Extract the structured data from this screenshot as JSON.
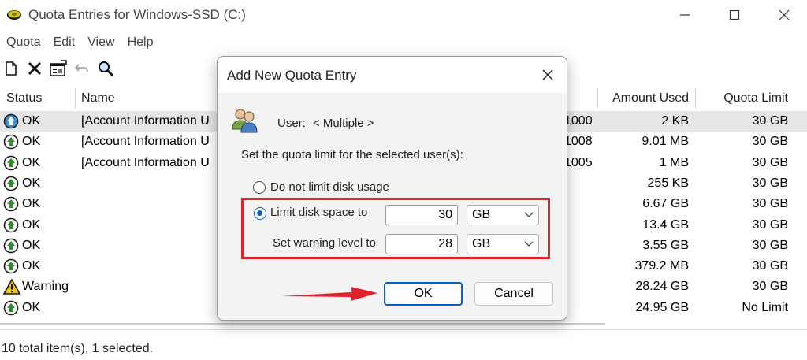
{
  "window": {
    "title": "Quota Entries for Windows-SSD (C:)",
    "controls": [
      "minimize",
      "maximize",
      "close"
    ]
  },
  "menu": [
    "Quota",
    "Edit",
    "View",
    "Help"
  ],
  "toolbar": {
    "icons": [
      "new-entry-icon",
      "delete-icon",
      "properties-icon",
      "undo-icon",
      "find-icon"
    ]
  },
  "table": {
    "columns": [
      "Status",
      "Name",
      "Amount Used",
      "Quota Limit"
    ],
    "rows": [
      {
        "status": "OK",
        "name": "[Account Information U",
        "login_tail": "1000",
        "used": "2 KB",
        "limit": "30 GB",
        "selected": true
      },
      {
        "status": "OK",
        "name": "[Account Information U",
        "login_tail": "1008",
        "used": "9.01 MB",
        "limit": "30 GB"
      },
      {
        "status": "OK",
        "name": "[Account Information U",
        "login_tail": "1005",
        "used": "1 MB",
        "limit": "30 GB"
      },
      {
        "status": "OK",
        "name": "",
        "login_tail": "",
        "used": "255 KB",
        "limit": "30 GB"
      },
      {
        "status": "OK",
        "name": "",
        "login_tail": "",
        "used": "6.67 GB",
        "limit": "30 GB"
      },
      {
        "status": "OK",
        "name": "",
        "login_tail": "",
        "used": "13.4 GB",
        "limit": "30 GB"
      },
      {
        "status": "OK",
        "name": "",
        "login_tail": "",
        "used": "3.55 GB",
        "limit": "30 GB"
      },
      {
        "status": "OK",
        "name": "",
        "login_tail": "",
        "used": "379.2 MB",
        "limit": "30 GB"
      },
      {
        "status": "Warning",
        "name": "",
        "login_tail": "",
        "used": "28.24 GB",
        "limit": "30 GB"
      },
      {
        "status": "OK",
        "name": "",
        "login_tail": "",
        "used": "24.95 GB",
        "limit": "No Limit"
      }
    ]
  },
  "statusbar": {
    "text": "10 total item(s), 1 selected."
  },
  "dialog": {
    "title": "Add New Quota Entry",
    "user_label": "User:",
    "user_value": "< Multiple >",
    "instruction": "Set the quota limit for the selected user(s):",
    "no_limit_label": "Do not limit disk usage",
    "limit_label": "Limit disk space to",
    "limit_value": "30",
    "limit_unit": "GB",
    "warning_label": "Set warning level to",
    "warning_value": "28",
    "warning_unit": "GB",
    "selected_option": "limit",
    "ok_label": "OK",
    "cancel_label": "Cancel"
  },
  "colors": {
    "highlight": "#e0202a",
    "accent": "#0a5fc4",
    "ok_status": "#2e8b2e",
    "warning_status": "#f2c200"
  }
}
